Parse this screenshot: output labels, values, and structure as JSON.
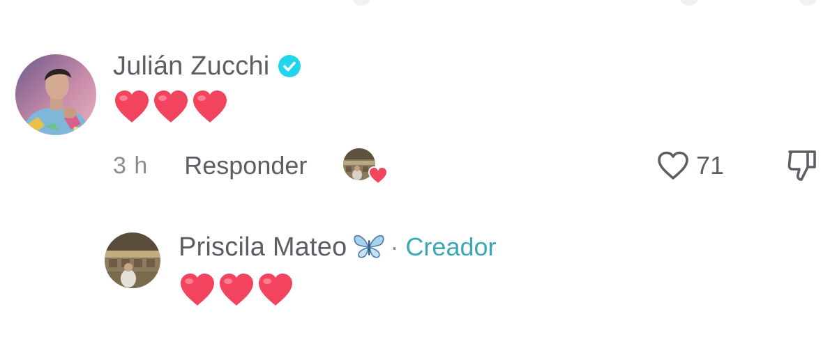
{
  "comments": [
    {
      "username": "Julián Zucchi",
      "verified": true,
      "text": "❤❤❤",
      "timestamp": "3 h",
      "reply_label": "Responder",
      "like_count": "71",
      "liked_by_creator": true
    }
  ],
  "reply": {
    "username": "Priscila Mateo",
    "separator": "·",
    "badge": "Creador",
    "text": "❤❤❤"
  },
  "icons": {
    "verified": "verified-check-icon",
    "butterfly": "butterfly-emoji-icon",
    "heart": "red-heart-emoji-icon",
    "like": "heart-outline-icon",
    "dislike": "thumbs-down-icon"
  },
  "colors": {
    "verified_blue": "#20d5ec",
    "creator_teal": "#3aa7b6",
    "heart_red": "#f2445e",
    "username_gray": "#5c5e66",
    "meta_gray": "#8a8b91"
  }
}
